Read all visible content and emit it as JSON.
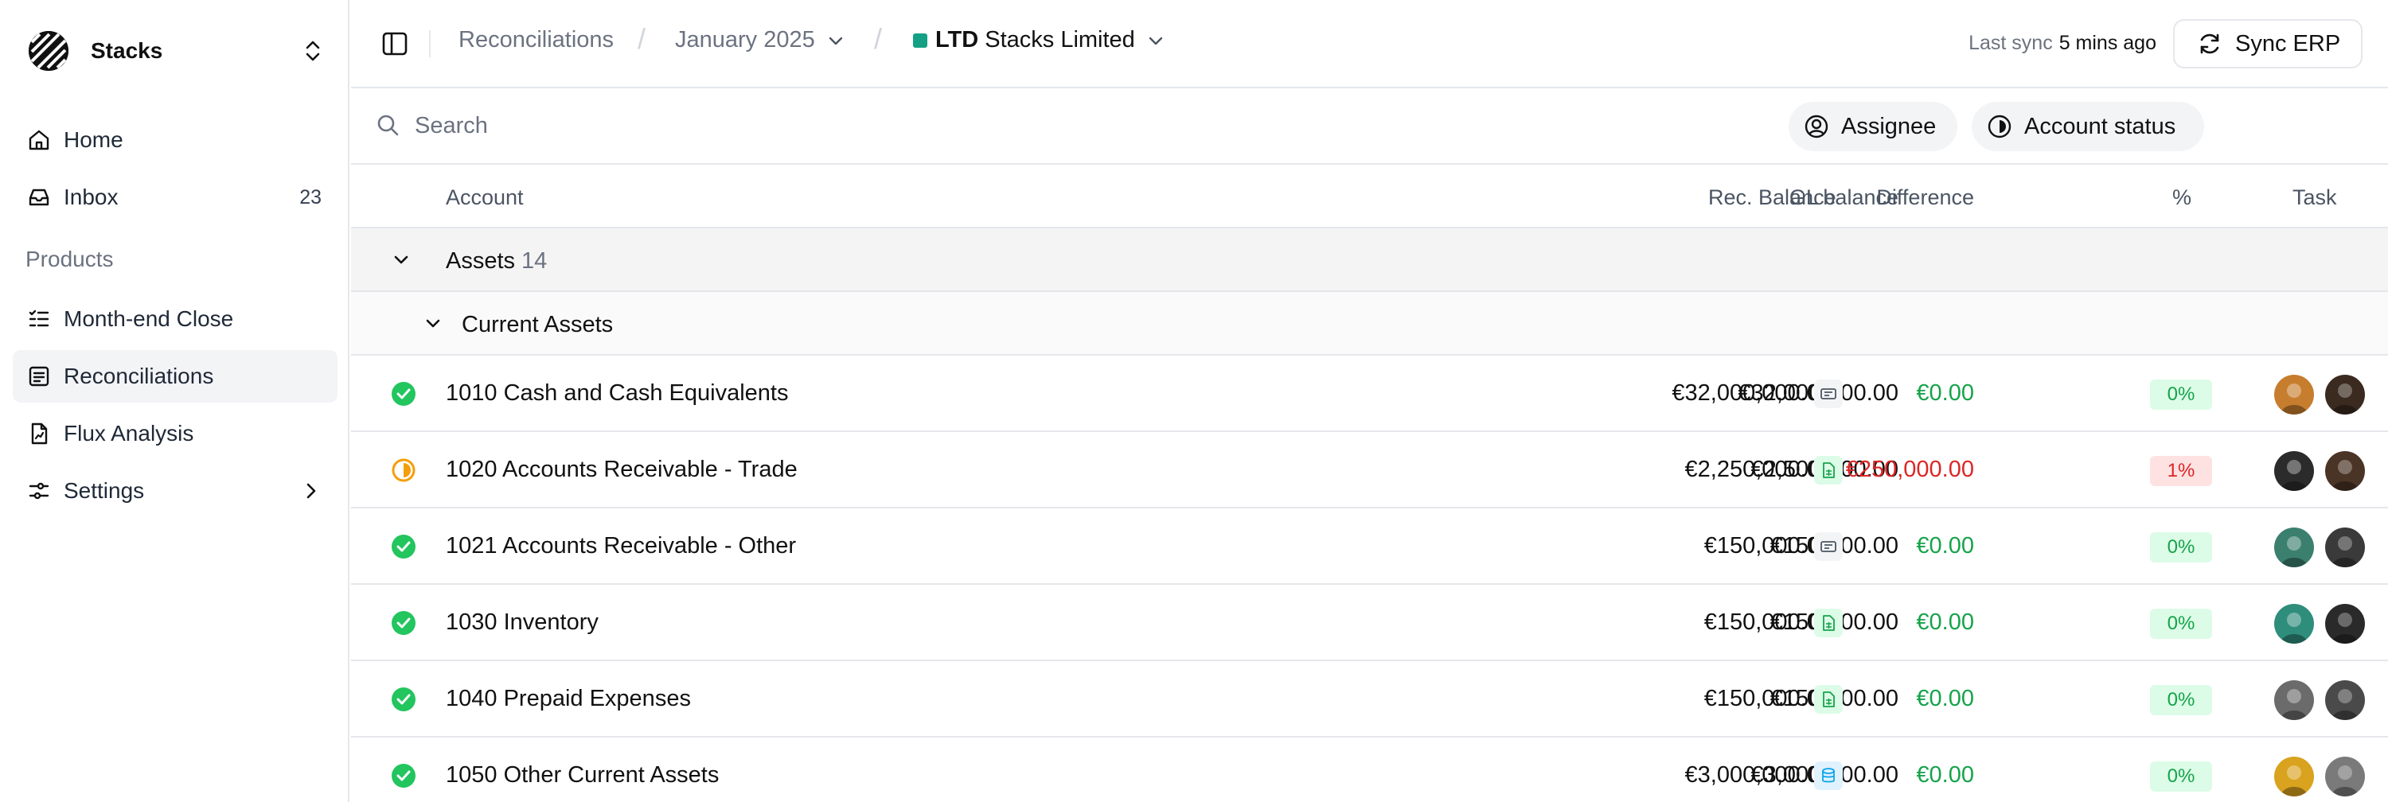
{
  "app": {
    "name": "Stacks"
  },
  "sidebar": {
    "items": [
      {
        "label": "Home",
        "icon": "home-icon"
      },
      {
        "label": "Inbox",
        "icon": "inbox-icon",
        "count": "23"
      }
    ],
    "section_label": "Products",
    "product_items": [
      {
        "label": "Month-end Close",
        "icon": "checklist-icon"
      },
      {
        "label": "Reconciliations",
        "icon": "ledger-icon",
        "active": true
      },
      {
        "label": "Flux Analysis",
        "icon": "file-chart-icon"
      },
      {
        "label": "Settings",
        "icon": "sliders-icon"
      }
    ]
  },
  "header": {
    "breadcrumb_root": "Reconciliations",
    "period": "January 2025",
    "entity_code": "LTD",
    "entity_name": "Stacks Limited",
    "entity_color": "#14a085",
    "last_sync_label": "Last sync",
    "last_sync_value": "5 mins ago",
    "sync_button": "Sync ERP"
  },
  "filters": {
    "search_placeholder": "Search",
    "assignee": "Assignee",
    "account_status": "Account status"
  },
  "table": {
    "columns": {
      "account": "Account",
      "gl_balance": "GL balance",
      "rec_balance": "Rec. Balance",
      "difference": "Difference",
      "percent": "%",
      "task": "Task"
    },
    "group": {
      "title": "Assets",
      "count": "14"
    },
    "subgroup": {
      "title": "Current Assets"
    },
    "rows": [
      {
        "status": "complete",
        "account": "1010 Cash and Cash Equivalents",
        "gl": "€32,000,000.00",
        "rec": "€32,000,000.00",
        "rec_icon": "bank-statement-icon",
        "diff": "€0.00",
        "pct": "0%",
        "state": "ok"
      },
      {
        "status": "in-progress",
        "account": "1020 Accounts Receivable - Trade",
        "gl": "€2,500,000.00",
        "rec": "€2,250,000.00",
        "rec_icon": "spreadsheet-icon",
        "diff": "€250,000.00",
        "pct": "1%",
        "state": "bad"
      },
      {
        "status": "complete",
        "account": "1021 Accounts Receivable - Other",
        "gl": "€150,000.00",
        "rec": "€150,000.00",
        "rec_icon": "bank-statement-icon",
        "diff": "€0.00",
        "pct": "0%",
        "state": "ok"
      },
      {
        "status": "complete",
        "account": "1030 Inventory",
        "gl": "€150,000.00",
        "rec": "€150,000.00",
        "rec_icon": "spreadsheet-icon",
        "diff": "€0.00",
        "pct": "0%",
        "state": "ok"
      },
      {
        "status": "complete",
        "account": "1040 Prepaid Expenses",
        "gl": "€150,000.00",
        "rec": "€150,000.00",
        "rec_icon": "spreadsheet-icon",
        "diff": "€0.00",
        "pct": "0%",
        "state": "ok"
      },
      {
        "status": "complete",
        "account": "1050 Other Current Assets",
        "gl": "€3,000,000.00",
        "rec": "€3,000,000.00",
        "rec_icon": "database-icon",
        "diff": "€0.00",
        "pct": "0%",
        "state": "ok"
      }
    ]
  },
  "colors": {
    "positive": "#16a34a",
    "negative": "#dc2626",
    "positive_bg": "#dcfce7",
    "negative_bg": "#fee2e2",
    "in_progress": "#f59e0b"
  }
}
